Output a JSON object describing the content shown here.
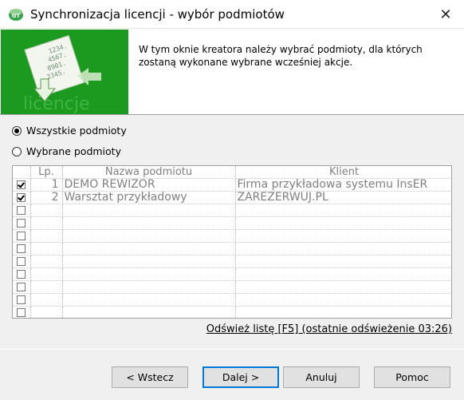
{
  "window": {
    "title": "Synchronizacja licencji - wybór podmiotów",
    "close_glyph": "✕"
  },
  "header": {
    "description": "W tym oknie kreatora należy wybrać podmioty, dla których zostaną wykonane wybrane wcześniej akcje.",
    "banner_numbers": [
      "1234.",
      "4567.",
      "8901.",
      "2345."
    ],
    "banner_watermark": "licencje",
    "banner_color": "#1c9a1f"
  },
  "options": {
    "all_label": "Wszystkie podmioty",
    "selected_label": "Wybrane podmioty",
    "selected_value": "all"
  },
  "grid": {
    "columns": [
      "Lp.",
      "Nazwa podmiotu",
      "Klient"
    ],
    "rows": [
      {
        "checked": true,
        "lp": "1",
        "name": "DEMO REWIZOR",
        "client": "Firma przykładowa systemu InsER"
      },
      {
        "checked": true,
        "lp": "2",
        "name": "Warsztat przykładowy",
        "client": "ZAREZERWUJ.PL"
      },
      {
        "checked": false,
        "lp": "",
        "name": "",
        "client": ""
      },
      {
        "checked": false,
        "lp": "",
        "name": "",
        "client": ""
      },
      {
        "checked": false,
        "lp": "",
        "name": "",
        "client": ""
      },
      {
        "checked": false,
        "lp": "",
        "name": "",
        "client": ""
      },
      {
        "checked": false,
        "lp": "",
        "name": "",
        "client": ""
      },
      {
        "checked": false,
        "lp": "",
        "name": "",
        "client": ""
      },
      {
        "checked": false,
        "lp": "",
        "name": "",
        "client": ""
      },
      {
        "checked": false,
        "lp": "",
        "name": "",
        "client": ""
      },
      {
        "checked": false,
        "lp": "",
        "name": "",
        "client": ""
      },
      {
        "checked": false,
        "lp": "",
        "name": "",
        "client": ""
      }
    ]
  },
  "refresh_link": "Odśwież listę [F5] (ostatnie odświeżenie 03:26)",
  "buttons": {
    "back": "< Wstecz",
    "next": "Dalej >",
    "cancel": "Anuluj",
    "help": "Pomoc"
  },
  "icons": {
    "app": "insert-gt-icon",
    "close": "close-icon"
  }
}
